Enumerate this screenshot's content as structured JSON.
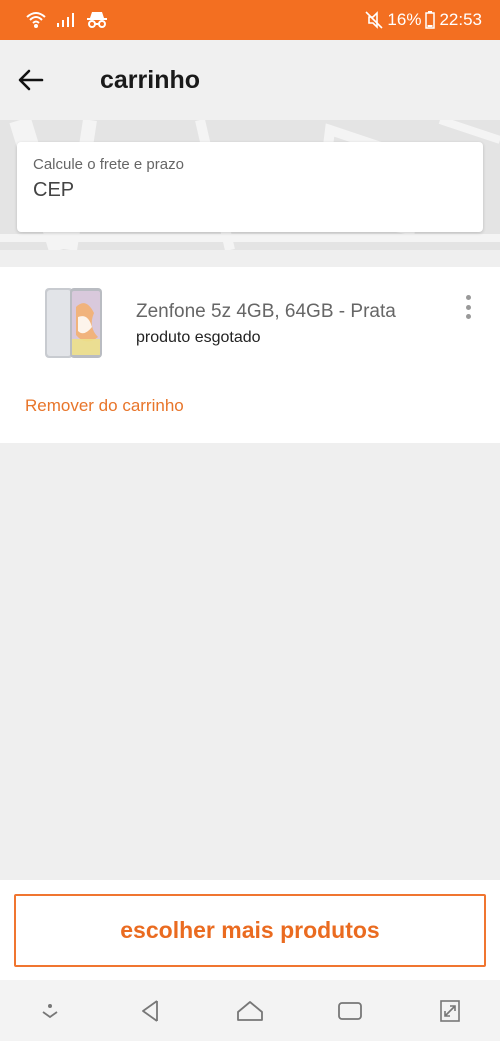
{
  "status_bar": {
    "battery": "16%",
    "time": "22:53",
    "icons": [
      "wifi-icon",
      "signal-icon",
      "incognito-icon",
      "mute-icon",
      "battery-icon"
    ]
  },
  "header": {
    "title": "carrinho",
    "back_icon": "arrow-left-icon"
  },
  "shipping": {
    "label": "Calcule o frete e prazo",
    "placeholder": "CEP",
    "value": ""
  },
  "cart": {
    "items": [
      {
        "name": "Zenfone 5z 4GB, 64GB - Prata",
        "status": "produto esgotado",
        "remove_label": "Remover do carrinho"
      }
    ]
  },
  "footer": {
    "more_products_label": "escolher mais produtos"
  },
  "nav": {
    "icons": [
      "chevron-down-icon",
      "back-triangle-icon",
      "home-icon",
      "recents-icon",
      "expand-icon"
    ]
  },
  "colors": {
    "accent": "#f36f21",
    "link": "#e8752a"
  }
}
